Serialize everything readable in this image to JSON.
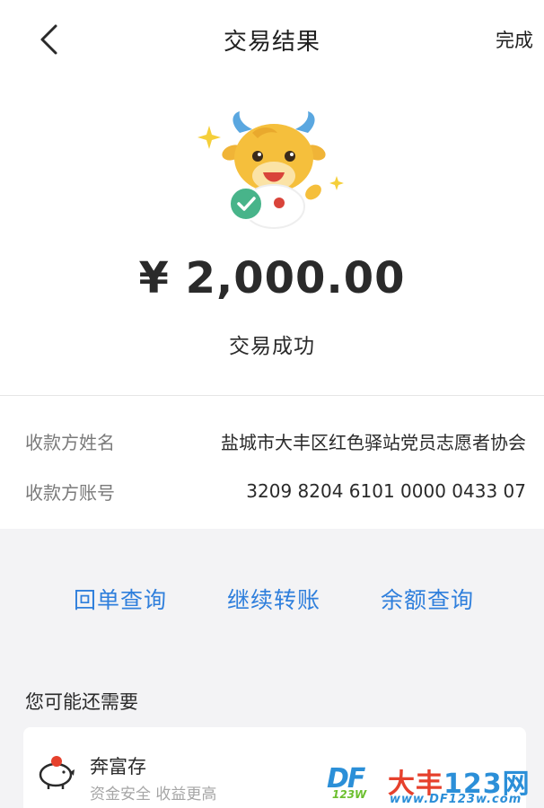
{
  "header": {
    "title": "交易结果",
    "done_label": "完成"
  },
  "result": {
    "amount": "¥ 2,000.00",
    "status": "交易成功",
    "icons": [
      "back-icon",
      "mascot-ox-icon",
      "success-check-icon"
    ],
    "accent_color": "#2f7fdc",
    "success_color": "#48b48a"
  },
  "details": {
    "payee_name_label": "收款方姓名",
    "payee_name_value": "盐城市大丰区红色驿站党员志愿者协会",
    "payee_account_label": "收款方账号",
    "payee_account_value": "3209 8204 6101 0000 0433 07"
  },
  "actions": {
    "receipt_label": "回单查询",
    "transfer_again_label": "继续转账",
    "balance_label": "余额查询"
  },
  "recommend": {
    "section_title": "您可能还需要",
    "card_title": "奔富存",
    "card_subtitle": "资金安全 收益更高",
    "card_icon": "piggy-bank-icon"
  },
  "watermark": {
    "logo_text": "DF",
    "logo_sub": "123W",
    "name_part1": "大丰",
    "name_part2": "123网",
    "url": "www.DF123w.com"
  }
}
